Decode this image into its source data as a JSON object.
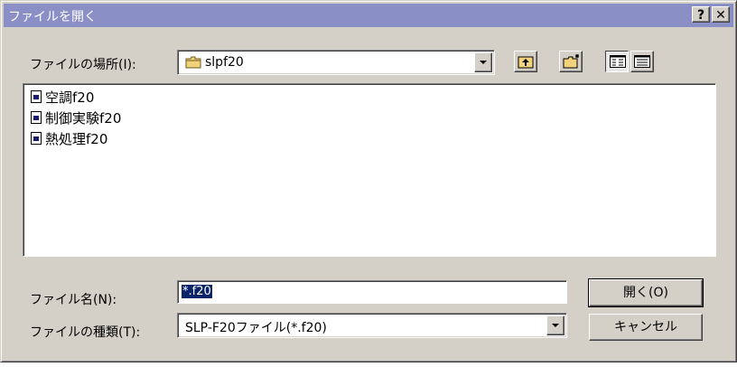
{
  "dialog": {
    "title": "ファイルを開く",
    "help_label": "?",
    "close_label": "✕"
  },
  "lookin": {
    "label": "ファイルの場所(I):",
    "value": "slpf20"
  },
  "toolbar": {
    "up_icon": "up-folder-icon",
    "new_folder_icon": "new-folder-icon",
    "list_view_icon": "list-view-icon",
    "details_view_icon": "details-view-icon"
  },
  "files": [
    {
      "name": "空調f20"
    },
    {
      "name": "制御実験f20"
    },
    {
      "name": "熱処理f20"
    }
  ],
  "filename": {
    "label": "ファイル名(N):",
    "value": "*.f20"
  },
  "filetype": {
    "label": "ファイルの種類(T):",
    "value": "SLP-F20ファイル(*.f20)"
  },
  "buttons": {
    "open": "開く(O)",
    "cancel": "キャンセル"
  },
  "colors": {
    "titlebar": "#8a8fc5",
    "face": "#d4d0c8",
    "selection": "#0a246a"
  }
}
